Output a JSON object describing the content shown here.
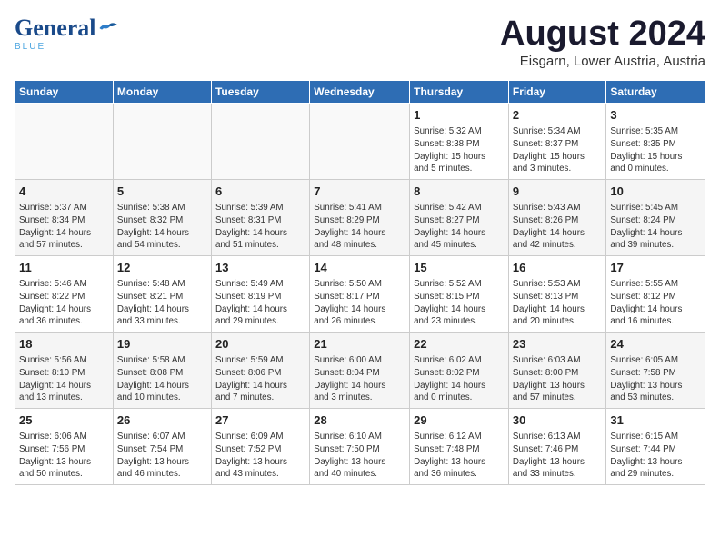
{
  "header": {
    "logo_general": "General",
    "logo_blue": "Blue",
    "month_title": "August 2024",
    "subtitle": "Eisgarn, Lower Austria, Austria"
  },
  "weekdays": [
    "Sunday",
    "Monday",
    "Tuesday",
    "Wednesday",
    "Thursday",
    "Friday",
    "Saturday"
  ],
  "weeks": [
    [
      {
        "day": "",
        "info": ""
      },
      {
        "day": "",
        "info": ""
      },
      {
        "day": "",
        "info": ""
      },
      {
        "day": "",
        "info": ""
      },
      {
        "day": "1",
        "info": "Sunrise: 5:32 AM\nSunset: 8:38 PM\nDaylight: 15 hours\nand 5 minutes."
      },
      {
        "day": "2",
        "info": "Sunrise: 5:34 AM\nSunset: 8:37 PM\nDaylight: 15 hours\nand 3 minutes."
      },
      {
        "day": "3",
        "info": "Sunrise: 5:35 AM\nSunset: 8:35 PM\nDaylight: 15 hours\nand 0 minutes."
      }
    ],
    [
      {
        "day": "4",
        "info": "Sunrise: 5:37 AM\nSunset: 8:34 PM\nDaylight: 14 hours\nand 57 minutes."
      },
      {
        "day": "5",
        "info": "Sunrise: 5:38 AM\nSunset: 8:32 PM\nDaylight: 14 hours\nand 54 minutes."
      },
      {
        "day": "6",
        "info": "Sunrise: 5:39 AM\nSunset: 8:31 PM\nDaylight: 14 hours\nand 51 minutes."
      },
      {
        "day": "7",
        "info": "Sunrise: 5:41 AM\nSunset: 8:29 PM\nDaylight: 14 hours\nand 48 minutes."
      },
      {
        "day": "8",
        "info": "Sunrise: 5:42 AM\nSunset: 8:27 PM\nDaylight: 14 hours\nand 45 minutes."
      },
      {
        "day": "9",
        "info": "Sunrise: 5:43 AM\nSunset: 8:26 PM\nDaylight: 14 hours\nand 42 minutes."
      },
      {
        "day": "10",
        "info": "Sunrise: 5:45 AM\nSunset: 8:24 PM\nDaylight: 14 hours\nand 39 minutes."
      }
    ],
    [
      {
        "day": "11",
        "info": "Sunrise: 5:46 AM\nSunset: 8:22 PM\nDaylight: 14 hours\nand 36 minutes."
      },
      {
        "day": "12",
        "info": "Sunrise: 5:48 AM\nSunset: 8:21 PM\nDaylight: 14 hours\nand 33 minutes."
      },
      {
        "day": "13",
        "info": "Sunrise: 5:49 AM\nSunset: 8:19 PM\nDaylight: 14 hours\nand 29 minutes."
      },
      {
        "day": "14",
        "info": "Sunrise: 5:50 AM\nSunset: 8:17 PM\nDaylight: 14 hours\nand 26 minutes."
      },
      {
        "day": "15",
        "info": "Sunrise: 5:52 AM\nSunset: 8:15 PM\nDaylight: 14 hours\nand 23 minutes."
      },
      {
        "day": "16",
        "info": "Sunrise: 5:53 AM\nSunset: 8:13 PM\nDaylight: 14 hours\nand 20 minutes."
      },
      {
        "day": "17",
        "info": "Sunrise: 5:55 AM\nSunset: 8:12 PM\nDaylight: 14 hours\nand 16 minutes."
      }
    ],
    [
      {
        "day": "18",
        "info": "Sunrise: 5:56 AM\nSunset: 8:10 PM\nDaylight: 14 hours\nand 13 minutes."
      },
      {
        "day": "19",
        "info": "Sunrise: 5:58 AM\nSunset: 8:08 PM\nDaylight: 14 hours\nand 10 minutes."
      },
      {
        "day": "20",
        "info": "Sunrise: 5:59 AM\nSunset: 8:06 PM\nDaylight: 14 hours\nand 7 minutes."
      },
      {
        "day": "21",
        "info": "Sunrise: 6:00 AM\nSunset: 8:04 PM\nDaylight: 14 hours\nand 3 minutes."
      },
      {
        "day": "22",
        "info": "Sunrise: 6:02 AM\nSunset: 8:02 PM\nDaylight: 14 hours\nand 0 minutes."
      },
      {
        "day": "23",
        "info": "Sunrise: 6:03 AM\nSunset: 8:00 PM\nDaylight: 13 hours\nand 57 minutes."
      },
      {
        "day": "24",
        "info": "Sunrise: 6:05 AM\nSunset: 7:58 PM\nDaylight: 13 hours\nand 53 minutes."
      }
    ],
    [
      {
        "day": "25",
        "info": "Sunrise: 6:06 AM\nSunset: 7:56 PM\nDaylight: 13 hours\nand 50 minutes."
      },
      {
        "day": "26",
        "info": "Sunrise: 6:07 AM\nSunset: 7:54 PM\nDaylight: 13 hours\nand 46 minutes."
      },
      {
        "day": "27",
        "info": "Sunrise: 6:09 AM\nSunset: 7:52 PM\nDaylight: 13 hours\nand 43 minutes."
      },
      {
        "day": "28",
        "info": "Sunrise: 6:10 AM\nSunset: 7:50 PM\nDaylight: 13 hours\nand 40 minutes."
      },
      {
        "day": "29",
        "info": "Sunrise: 6:12 AM\nSunset: 7:48 PM\nDaylight: 13 hours\nand 36 minutes."
      },
      {
        "day": "30",
        "info": "Sunrise: 6:13 AM\nSunset: 7:46 PM\nDaylight: 13 hours\nand 33 minutes."
      },
      {
        "day": "31",
        "info": "Sunrise: 6:15 AM\nSunset: 7:44 PM\nDaylight: 13 hours\nand 29 minutes."
      }
    ]
  ]
}
